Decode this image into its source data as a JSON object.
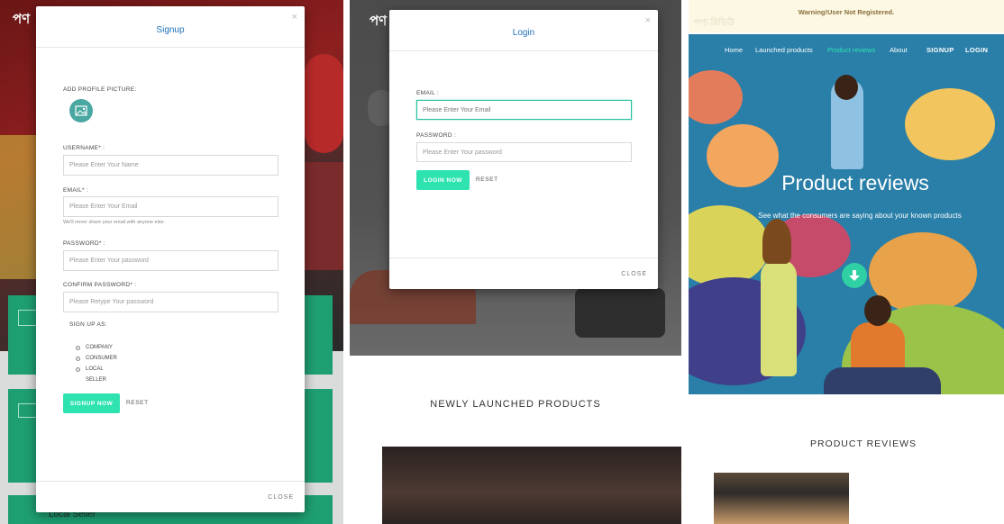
{
  "panel1": {
    "brand": "পণ",
    "card_label": "Local Seller",
    "signup_modal": {
      "title": "Signup",
      "close_x": "×",
      "profile_label": "ADD PROFILE PICTURE:",
      "username_label": "USERNAME* :",
      "username_placeholder": "Please Enter Your Name",
      "email_label": "EMAIL* :",
      "email_placeholder": "Please Enter Your Email",
      "email_help": "We'll never share your email with anyone else.",
      "password_label": "PASSWORD* :",
      "password_placeholder": "Please Enter Your password",
      "confirm_label": "CONFIRM PASSWORD* :",
      "confirm_placeholder": "Please Retype Your password",
      "signup_as_label": "SIGN UP AS:",
      "options": [
        "COMPANY",
        "CONSUMER",
        "LOCAL"
      ],
      "option_extra": "SELLER",
      "signup_button": "SIGNUP NOW",
      "reset_button": "RESET",
      "close_button": "CLOSE"
    }
  },
  "panel2": {
    "brand": "পণ",
    "section_title": "NEWLY LAUNCHED PRODUCTS",
    "login_modal": {
      "title": "Login",
      "close_x": "×",
      "email_label": "EMAIL :",
      "email_placeholder": "Please Enter Your Email",
      "password_label": "PASSWORD :",
      "password_placeholder": "Please Enter Your password",
      "login_button": "LOGIN NOW",
      "reset_button": "RESET",
      "close_button": "CLOSE"
    }
  },
  "panel3": {
    "warning": "Warning!User Not Registered.",
    "brand": "পণ্য রিভিউ",
    "nav": {
      "home": "Home",
      "launched": "Launched products",
      "reviews": "Product reviews",
      "about": "About",
      "signup": "SIGNUP",
      "login": "LOGIN"
    },
    "hero_title": "Product reviews",
    "hero_subtitle": "See what the consumers are saying about your known products",
    "section_title": "PRODUCT REVIEWS"
  },
  "colors": {
    "accent": "#2fe3b1",
    "link_blue": "#1e6fb8",
    "hero_blue": "#2a7fa8",
    "warning_bg": "#fcf8e3",
    "warning_text": "#8a6d3b",
    "green_card": "#1e9f72"
  }
}
